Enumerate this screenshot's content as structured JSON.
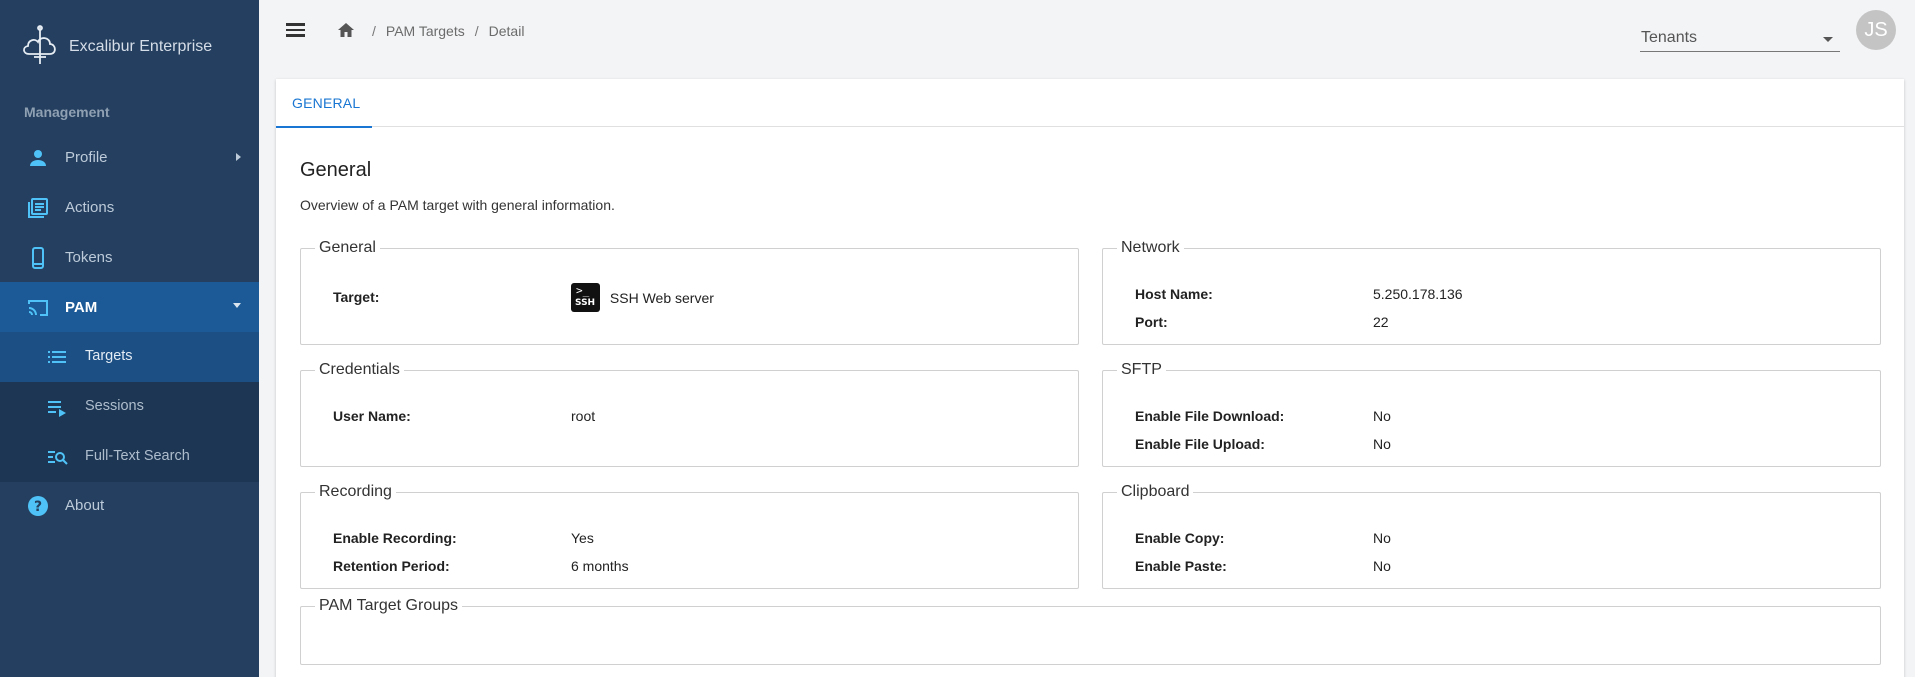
{
  "app": {
    "brand": "Excalibur Enterprise"
  },
  "sidebar": {
    "section_label": "Management",
    "items": [
      {
        "label": "Profile",
        "icon": "person-icon"
      },
      {
        "label": "Actions",
        "icon": "actions-icon"
      },
      {
        "label": "Tokens",
        "icon": "phone-icon"
      },
      {
        "label": "PAM",
        "icon": "cast-icon"
      },
      {
        "label": "About",
        "icon": "help-icon"
      }
    ],
    "pam_sub": [
      {
        "label": "Targets",
        "icon": "list-icon"
      },
      {
        "label": "Sessions",
        "icon": "playlist-icon"
      },
      {
        "label": "Full-Text Search",
        "icon": "search-list-icon"
      }
    ]
  },
  "header": {
    "breadcrumb": [
      "PAM Targets",
      "Detail"
    ],
    "tenants_label": "Tenants",
    "avatar_initials": "JS"
  },
  "tabs": [
    {
      "label": "GENERAL"
    }
  ],
  "main": {
    "title": "General",
    "subtitle": "Overview of a PAM target with general information.",
    "general": {
      "legend": "General",
      "target_label": "Target:",
      "ssh_badge": "SSH",
      "ssh_prompt": ">_",
      "target_value": "SSH Web server"
    },
    "network": {
      "legend": "Network",
      "host_label": "Host Name:",
      "host_value": "5.250.178.136",
      "port_label": "Port:",
      "port_value": "22"
    },
    "credentials": {
      "legend": "Credentials",
      "user_label": "User Name:",
      "user_value": "root"
    },
    "sftp": {
      "legend": "SFTP",
      "download_label": "Enable File Download:",
      "download_value": "No",
      "upload_label": "Enable File Upload:",
      "upload_value": "No"
    },
    "recording": {
      "legend": "Recording",
      "enable_label": "Enable Recording:",
      "enable_value": "Yes",
      "retention_label": "Retention Period:",
      "retention_value": "6 months"
    },
    "clipboard": {
      "legend": "Clipboard",
      "copy_label": "Enable Copy:",
      "copy_value": "No",
      "paste_label": "Enable Paste:",
      "paste_value": "No"
    },
    "groups": {
      "legend": "PAM Target Groups"
    }
  },
  "colors": {
    "sidebar_bg": "#243f5f",
    "sidebar_active": "#1b5a96",
    "sub_bg": "#1d3653",
    "accent": "#1976d2",
    "nav_icon": "#4fc3f7"
  }
}
